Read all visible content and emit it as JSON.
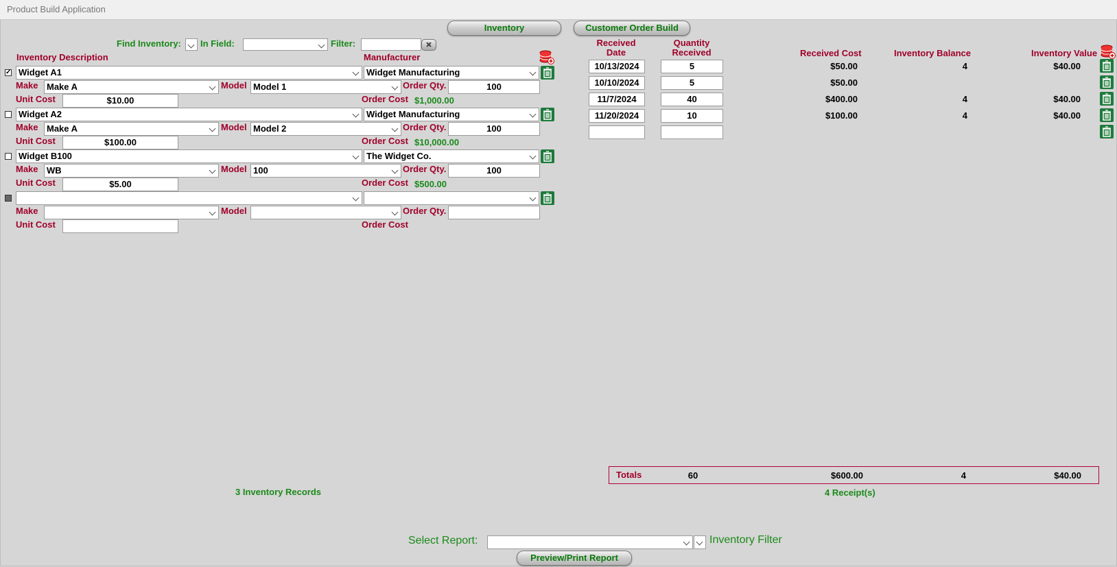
{
  "window": {
    "title": "Product Build Application"
  },
  "nav": {
    "inventory": "Inventory",
    "customer_order_build": "Customer Order Build"
  },
  "search": {
    "find_label": "Find Inventory:",
    "in_field_label": "In Field:",
    "filter_label": "Filter:",
    "in_field_value": "",
    "filter_value": ""
  },
  "headers": {
    "description": "Inventory Description",
    "manufacturer": "Manufacturer"
  },
  "labels": {
    "make": "Make",
    "model": "Model",
    "order_qty": "Order Qty.",
    "unit_cost": "Unit Cost",
    "order_cost": "Order Cost"
  },
  "records": [
    {
      "checked": true,
      "description": "Widget A1",
      "manufacturer": "Widget Manufacturing",
      "make": "Make A",
      "model": "Model 1",
      "order_qty": "100",
      "unit_cost": "$10.00",
      "order_cost": "$1,000.00"
    },
    {
      "checked": false,
      "description": "Widget A2",
      "manufacturer": "Widget Manufacturing",
      "make": "Make A",
      "model": "Model 2",
      "order_qty": "100",
      "unit_cost": "$100.00",
      "order_cost": "$10,000.00"
    },
    {
      "checked": false,
      "description": "Widget B100",
      "manufacturer": "The Widget Co.",
      "make": "WB",
      "model": "100",
      "order_qty": "100",
      "unit_cost": "$5.00",
      "order_cost": "$500.00"
    },
    {
      "checked": false,
      "description": "",
      "manufacturer": "",
      "make": "",
      "model": "",
      "order_qty": "",
      "unit_cost": "",
      "order_cost": ""
    }
  ],
  "inventory_count": "3 Inventory Records",
  "receipt_headers": {
    "received_date_1": "Received",
    "received_date_2": "Date",
    "qty_received_1": "Quantity",
    "qty_received_2": "Received",
    "received_cost": "Received Cost",
    "inventory_balance": "Inventory Balance",
    "inventory_value": "Inventory Value"
  },
  "receipts": [
    {
      "date": "10/13/2024",
      "qty": "5",
      "cost": "$50.00",
      "balance": "4",
      "value": "$40.00"
    },
    {
      "date": "10/10/2024",
      "qty": "5",
      "cost": "$50.00",
      "balance": "",
      "value": ""
    },
    {
      "date": "11/7/2024",
      "qty": "40",
      "cost": "$400.00",
      "balance": "4",
      "value": "$40.00"
    },
    {
      "date": "11/20/2024",
      "qty": "10",
      "cost": "$100.00",
      "balance": "4",
      "value": "$40.00"
    },
    {
      "date": "",
      "qty": "",
      "cost": "",
      "balance": "",
      "value": ""
    }
  ],
  "totals": {
    "label": "Totals",
    "qty": "60",
    "cost": "$600.00",
    "balance": "4",
    "value": "$40.00"
  },
  "receipt_count": "4 Receipt(s)",
  "report": {
    "select_label": "Select Report:",
    "select_value": "",
    "filter_label": "Inventory Filter",
    "preview_button": "Preview/Print Report"
  },
  "colors": {
    "label_red": "#a0002a",
    "label_green": "#1a8a1a",
    "trash_green": "#1e7a3c",
    "background": "#d6d6d6"
  },
  "icons": {
    "trash": "trash-icon",
    "database_add": "database-add-icon",
    "clear": "clear-filter-icon",
    "dropdown": "chevron-down-icon"
  }
}
